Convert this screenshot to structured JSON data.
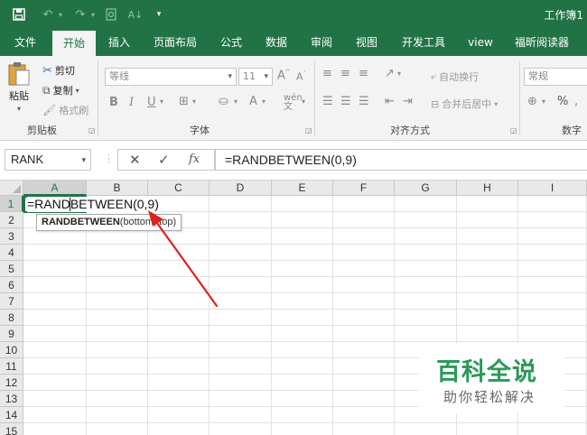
{
  "window": {
    "title": "工作簿1"
  },
  "quick_access": {
    "save_icon": "save-icon",
    "undo_icon": "undo-icon",
    "redo_icon": "redo-icon",
    "print_preview_icon": "print-preview-icon",
    "sort_icon": "sort-icon",
    "customize_icon": "customize-icon"
  },
  "tabs": [
    {
      "label": "文件"
    },
    {
      "label": "开始",
      "active": true
    },
    {
      "label": "插入"
    },
    {
      "label": "页面布局"
    },
    {
      "label": "公式"
    },
    {
      "label": "数据"
    },
    {
      "label": "审阅"
    },
    {
      "label": "视图"
    },
    {
      "label": "开发工具"
    },
    {
      "label": "view"
    },
    {
      "label": "福昕阅读器"
    }
  ],
  "ribbon": {
    "clipboard": {
      "paste": "粘贴",
      "cut": "剪切",
      "copy": "复制",
      "format_painter": "格式刷",
      "label": "剪贴板"
    },
    "font": {
      "font_name": "等线",
      "font_size": "11",
      "bold": "B",
      "italic": "I",
      "underline": "U",
      "label": "字体"
    },
    "alignment": {
      "wrap_text": "自动换行",
      "merge_center": "合并后居中",
      "label": "对齐方式"
    },
    "number": {
      "format": "常规",
      "percent": "%",
      "label": "数字"
    }
  },
  "formula_bar": {
    "name_box": "RANK",
    "cancel": "✕",
    "enter": "✓",
    "fx": "fx",
    "formula": "=RANDBETWEEN(0,9)"
  },
  "sheet": {
    "columns": [
      "A",
      "B",
      "C",
      "D",
      "E",
      "F",
      "G",
      "H",
      "I"
    ],
    "rows": [
      "1",
      "2",
      "3",
      "4",
      "5",
      "6",
      "7",
      "8",
      "9",
      "10",
      "11",
      "12",
      "13",
      "14",
      "15"
    ],
    "active_cell": "A1",
    "cell_a1_text": "=RANDBETWEEN(0,9)",
    "tooltip_function": "RANDBETWEEN",
    "tooltip_args": "(bottom, top)"
  },
  "watermark": {
    "main": "百科全说",
    "sub": "助你轻松解决"
  },
  "colors": {
    "excel_green": "#217346",
    "annotation_red": "#e02020",
    "watermark_green": "#2a9a57"
  }
}
